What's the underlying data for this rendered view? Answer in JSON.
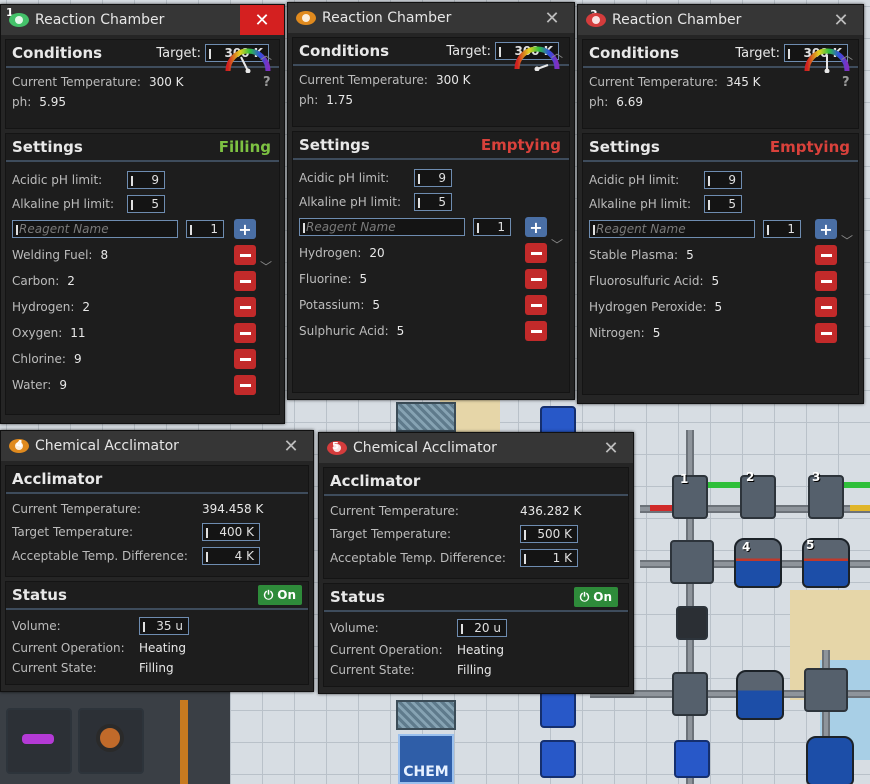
{
  "chambers": [
    {
      "num": "1",
      "title": "Reaction Chamber",
      "icon_color": "#44c26a",
      "close_highlight": true,
      "conditions_label": "Conditions",
      "target_label": "Target:",
      "target_value": "300 K",
      "current_temp_label": "Current Temperature:",
      "current_temp": "300 K",
      "ph_label": "ph:",
      "ph": "5.95",
      "settings_label": "Settings",
      "mode": "Filling",
      "mode_color": "#7dc242",
      "acidic_label": "Acidic pH limit:",
      "acidic_value": "9",
      "alkaline_label": "Alkaline pH limit:",
      "alkaline_value": "5",
      "reagent_placeholder": "Reagent Name",
      "reagent_amount": "1",
      "reagents": [
        {
          "name": "Welding Fuel:",
          "amount": "8"
        },
        {
          "name": "Carbon:",
          "amount": "2"
        },
        {
          "name": "Hydrogen:",
          "amount": "2"
        },
        {
          "name": "Oxygen:",
          "amount": "11"
        },
        {
          "name": "Chlorine:",
          "amount": "9"
        },
        {
          "name": "Water:",
          "amount": "9"
        }
      ]
    },
    {
      "num": "2",
      "title": "Reaction Chamber",
      "icon_color": "#e08a1e",
      "close_highlight": false,
      "conditions_label": "Conditions",
      "target_label": "Target:",
      "target_value": "300 K",
      "current_temp_label": "Current Temperature:",
      "current_temp": "300 K",
      "ph_label": "ph:",
      "ph": "1.75",
      "settings_label": "Settings",
      "mode": "Emptying",
      "mode_color": "#d9413b",
      "acidic_label": "Acidic pH limit:",
      "acidic_value": "9",
      "alkaline_label": "Alkaline pH limit:",
      "alkaline_value": "5",
      "reagent_placeholder": "Reagent Name",
      "reagent_amount": "1",
      "reagents": [
        {
          "name": "Hydrogen:",
          "amount": "20"
        },
        {
          "name": "Fluorine:",
          "amount": "5"
        },
        {
          "name": "Potassium:",
          "amount": "5"
        },
        {
          "name": "Sulphuric Acid:",
          "amount": "5"
        }
      ]
    },
    {
      "num": "3",
      "title": "Reaction Chamber",
      "icon_color": "#d43c3c",
      "close_highlight": false,
      "conditions_label": "Conditions",
      "target_label": "Target:",
      "target_value": "300 K",
      "current_temp_label": "Current Temperature:",
      "current_temp": "345 K",
      "ph_label": "ph:",
      "ph": "6.69",
      "settings_label": "Settings",
      "mode": "Emptying",
      "mode_color": "#d9413b",
      "acidic_label": "Acidic pH limit:",
      "acidic_value": "9",
      "alkaline_label": "Alkaline pH limit:",
      "alkaline_value": "5",
      "reagent_placeholder": "Reagent Name",
      "reagent_amount": "1",
      "reagents": [
        {
          "name": "Stable Plasma:",
          "amount": "5"
        },
        {
          "name": "Fluorosulfuric Acid:",
          "amount": "5"
        },
        {
          "name": "Hydrogen Peroxide:",
          "amount": "5"
        },
        {
          "name": "Nitrogen:",
          "amount": "5"
        }
      ]
    }
  ],
  "acclimators": [
    {
      "num": "4",
      "title": "Chemical Acclimator",
      "icon_color": "#e08a1e",
      "section_label": "Acclimator",
      "current_temp_label": "Current Temperature:",
      "current_temp": "394.458 K",
      "target_temp_label": "Target Temperature:",
      "target_temp": "400 K",
      "diff_label": "Acceptable Temp. Difference:",
      "diff": "4 K",
      "status_label": "Status",
      "on_label": "On",
      "volume_label": "Volume:",
      "volume": "35 u",
      "operation_label": "Current Operation:",
      "operation": "Heating",
      "state_label": "Current State:",
      "state": "Filling"
    },
    {
      "num": "5",
      "title": "Chemical Acclimator",
      "icon_color": "#d43c3c",
      "section_label": "Acclimator",
      "current_temp_label": "Current Temperature:",
      "current_temp": "436.282 K",
      "target_temp_label": "Target Temperature:",
      "target_temp": "500 K",
      "diff_label": "Acceptable Temp. Difference:",
      "diff": "1 K",
      "status_label": "Status",
      "on_label": "On",
      "volume_label": "Volume:",
      "volume": "20 u",
      "operation_label": "Current Operation:",
      "operation": "Heating",
      "state_label": "Current State:",
      "state": "Filling"
    }
  ],
  "world": {
    "labels": [
      "1",
      "2",
      "3",
      "4",
      "5"
    ],
    "sign_text": "CHEM"
  },
  "icons": {
    "close": "close-icon",
    "add": "plus-icon",
    "remove": "minus-icon",
    "power": "power-icon",
    "help": "?"
  }
}
